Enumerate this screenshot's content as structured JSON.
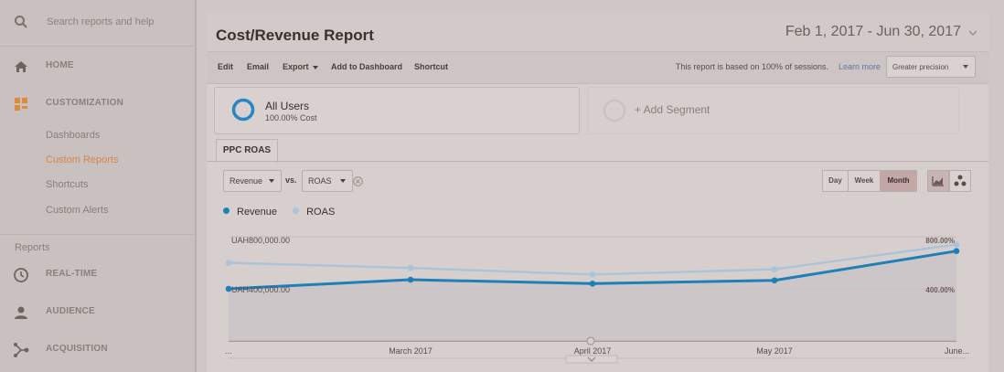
{
  "sidebar": {
    "search_placeholder": "Search reports and help",
    "nav": [
      {
        "label": "HOME",
        "icon": "home-icon"
      },
      {
        "label": "CUSTOMIZATION",
        "icon": "customization-icon"
      }
    ],
    "customization_items": [
      "Dashboards",
      "Custom Reports",
      "Shortcuts",
      "Custom Alerts"
    ],
    "active_item": "Custom Reports",
    "reports_title": "Reports",
    "reports_nav": [
      {
        "label": "REAL-TIME",
        "icon": "clock-icon"
      },
      {
        "label": "AUDIENCE",
        "icon": "person-icon"
      },
      {
        "label": "ACQUISITION",
        "icon": "acquisition-icon"
      }
    ]
  },
  "header": {
    "title": "Cost/Revenue Report",
    "date_range": "Feb 1, 2017 - Jun 30, 2017"
  },
  "toolbar": {
    "edit": "Edit",
    "email": "Email",
    "export": "Export",
    "add_to_dashboard": "Add to Dashboard",
    "shortcut": "Shortcut",
    "sampling_text": "This report is based on 100% of sessions.",
    "learn_more": "Learn more",
    "precision": "Greater precision"
  },
  "segments": {
    "active_name": "All Users",
    "active_sub": "100.00% Cost",
    "add_label": "+ Add Segment"
  },
  "tabs": [
    "PPC ROAS"
  ],
  "controls": {
    "metric1": "Revenue",
    "vs": "vs.",
    "metric2": "ROAS",
    "periods": [
      "Day",
      "Week",
      "Month"
    ],
    "active_period": "Month"
  },
  "legend": [
    {
      "name": "Revenue",
      "color": "#1f7fb8"
    },
    {
      "name": "ROAS",
      "color": "#a9c4d8"
    }
  ],
  "chart_data": {
    "type": "line",
    "x": [
      "...",
      "March 2017",
      "April 2017",
      "May 2017",
      "June..."
    ],
    "left_axis_ticks": [
      "UAH800,000.00",
      "UAH400,000.00"
    ],
    "right_axis_ticks": [
      "800.00%",
      "400.00%"
    ],
    "series": [
      {
        "name": "Revenue",
        "axis": "left",
        "color": "#1f7fb8",
        "values": [
          400000,
          470000,
          440000,
          465000,
          690000
        ]
      },
      {
        "name": "ROAS",
        "axis": "right",
        "color": "#a9c4d8",
        "values": [
          600,
          560,
          510,
          550,
          740
        ]
      }
    ],
    "ylim_left": [
      0,
      800000
    ],
    "ylim_right": [
      0,
      800
    ]
  }
}
